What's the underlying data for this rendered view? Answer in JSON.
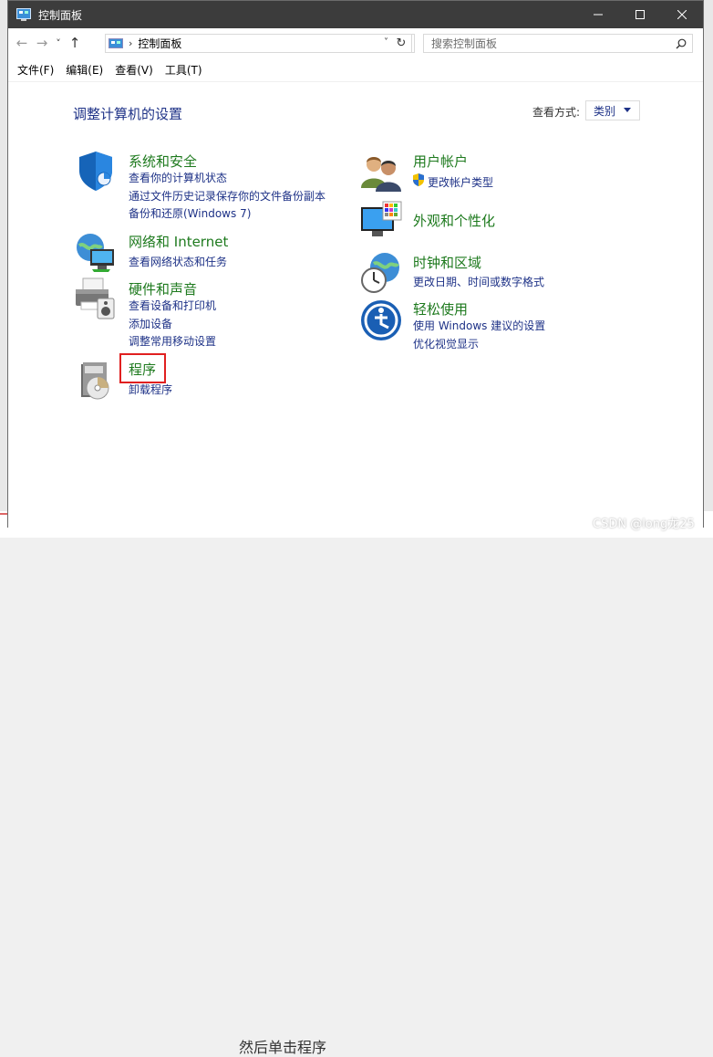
{
  "window": {
    "title": "控制面板",
    "controls": {
      "minimize": "—",
      "maximize": "☐",
      "close": "✕"
    }
  },
  "navigation": {
    "back": "←",
    "forward": "→",
    "recent": "˅",
    "up": "↑",
    "address_separator": "›",
    "address_text": "控制面板",
    "dropdown": "˅",
    "refresh": "↻",
    "search_placeholder": "搜索控制面板"
  },
  "menu": [
    "文件(F)",
    "编辑(E)",
    "查看(V)",
    "工具(T)"
  ],
  "content": {
    "heading": "调整计算机的设置",
    "view_by_label": "查看方式:",
    "view_by_value": "类别"
  },
  "categories_left": [
    {
      "title": "系统和安全",
      "icon": "shield-icon",
      "links": [
        "查看你的计算机状态",
        "通过文件历史记录保存你的文件备份副本",
        "备份和还原(Windows 7)"
      ]
    },
    {
      "title": "网络和 Internet",
      "icon": "network-globe-icon",
      "links": [
        "查看网络状态和任务"
      ]
    },
    {
      "title": "硬件和声音",
      "icon": "printer-speaker-icon",
      "links": [
        "查看设备和打印机",
        "添加设备",
        "调整常用移动设置"
      ]
    },
    {
      "title": "程序",
      "icon": "programs-disc-icon",
      "links": [
        "卸载程序"
      ]
    }
  ],
  "categories_right": [
    {
      "title": "用户帐户",
      "icon": "users-icon",
      "links": [
        "更改帐户类型"
      ]
    },
    {
      "title": "外观和个性化",
      "icon": "monitor-palette-icon",
      "links": []
    },
    {
      "title": "时钟和区域",
      "icon": "clock-globe-icon",
      "links": [
        "更改日期、时间或数字格式"
      ]
    },
    {
      "title": "轻松使用",
      "icon": "ease-of-access-icon",
      "links": [
        "使用 Windows 建议的设置",
        "优化视觉显示"
      ]
    }
  ],
  "background_text": "然后单击程序",
  "watermark": "CSDN @long龙25",
  "colors": {
    "title_green": "#1e7a1e",
    "link_blue": "#1e3287",
    "highlight_red": "#e02020",
    "titlebar": "#3c3c3c"
  }
}
